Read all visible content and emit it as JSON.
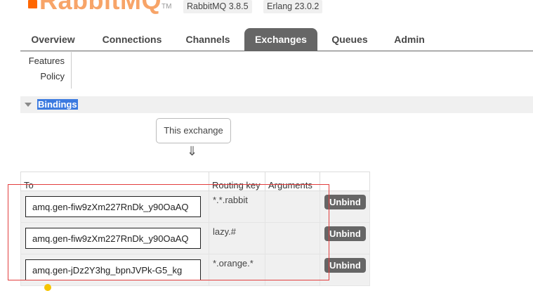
{
  "header": {
    "logo_text": "RabbitMQ",
    "logo_tm": "TM",
    "rabbit_version": "RabbitMQ 3.8.5",
    "erlang_version": "Erlang 23.0.2"
  },
  "tabs": [
    {
      "label": "Overview"
    },
    {
      "label": "Connections"
    },
    {
      "label": "Channels"
    },
    {
      "label": "Exchanges",
      "active": true
    },
    {
      "label": "Queues"
    },
    {
      "label": "Admin"
    }
  ],
  "subnav": [
    "Features",
    "Policy"
  ],
  "section": {
    "title": "Bindings"
  },
  "this_exchange": "This exchange",
  "arrow": "⇓",
  "table": {
    "headers": [
      "To",
      "Routing key",
      "Arguments",
      ""
    ],
    "rows": [
      {
        "to": "amq.gen-fiw9zXm227RnDk_y90OaAQ",
        "routing_key": "*.*.rabbit",
        "arguments": "",
        "action": "Unbind"
      },
      {
        "to": "amq.gen-fiw9zXm227RnDk_y90OaAQ",
        "routing_key": "lazy.#",
        "arguments": "",
        "action": "Unbind"
      },
      {
        "to": "amq.gen-jDz2Y3hg_bpnJVPk-G5_kg",
        "routing_key": "*.orange.*",
        "arguments": "",
        "action": "Unbind"
      }
    ]
  },
  "colors": {
    "accent": "#666666",
    "logo": "#ff6600",
    "highlight": "#3b7ae0",
    "annotation": "#e23e3e"
  }
}
